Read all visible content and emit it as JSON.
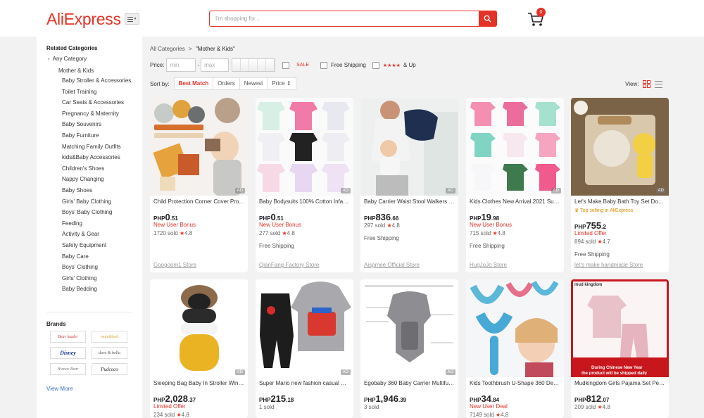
{
  "header": {
    "logo": "AliExpress",
    "search_placeholder": "I'm shopping for...",
    "cart_count": "0",
    "brand_color": "#e43225"
  },
  "sidebar": {
    "title": "Related Categories",
    "back_label": "Any Category",
    "current": "Mother & Kids",
    "items": [
      "Baby Stroller & Accessories",
      "Toilet Training",
      "Car Seats & Accessories",
      "Pregnancy & Maternity",
      "Baby Souvenirs",
      "Baby Furniture",
      "Matching Family Outfits",
      "kids&Baby Accessories",
      "Children's Shoes",
      "Nappy Changing",
      "Baby Shoes",
      "Girls' Baby Clothing",
      "Boys' Baby Clothing",
      "Feeding",
      "Activity & Gear",
      "Safety Equipment",
      "Baby Care",
      "Boys' Clothing",
      "Girls' Clothing",
      "Baby Bedding"
    ],
    "brands_title": "Brands",
    "brands": [
      "Bear leader",
      "mom&bab",
      "Disney",
      "dave & bella",
      "Humor Bear",
      "Pudcoco"
    ],
    "view_more": "View More"
  },
  "breadcrumb": {
    "root": "All Categories",
    "sep": ">",
    "current": "\"Mother & Kids\""
  },
  "filters": {
    "price_label": "Price:",
    "min_placeholder": "min",
    "dash": "-",
    "max_placeholder": "max",
    "sale_label": "SALE",
    "free_shipping_label": "Free Shipping",
    "rating_stars": "★★★★",
    "rating_label": "& Up"
  },
  "sort": {
    "label": "Sort by:",
    "options": [
      "Best Match",
      "Orders",
      "Newest",
      "Price ⇕"
    ],
    "active": "Best Match"
  },
  "view": {
    "label": "View:"
  },
  "products": [
    {
      "title": "Child Protection Corner Cover Prot…",
      "currency": "PHP",
      "price_int": "0",
      "price_dec": ".51",
      "promo": "New User Bonus",
      "sold": "1720 sold",
      "rating": "4.8",
      "shipping": "",
      "store": "Googoom1 Store",
      "ad": "AD"
    },
    {
      "title": "Baby Bodysuits 100% Cotton Infan…",
      "currency": "PHP",
      "price_int": "0",
      "price_dec": ".51",
      "promo": "New User Bonus",
      "sold": "277 sold",
      "rating": "4.8",
      "shipping": "Free Shipping",
      "store": "QianFang Factory Store",
      "ad": "AD"
    },
    {
      "title": "Baby Carrier Waist Stool Walkers B…",
      "currency": "PHP",
      "price_int": "836",
      "price_dec": ".66",
      "promo": "",
      "sold": "297 sold",
      "rating": "4.8",
      "shipping": "Free Shipping",
      "store": "Aispmee Official Store",
      "ad": "AD"
    },
    {
      "title": "Kids Clothes New Arrival 2021 Sum…",
      "currency": "PHP",
      "price_int": "19",
      "price_dec": ".98",
      "promo": "New User Bonus",
      "sold": "715 sold",
      "rating": "4.8",
      "shipping": "Free Shipping",
      "store": "HugJoJo Store",
      "ad": "AD"
    },
    {
      "title": "Let's Make Baby Bath Toy Set Dou…",
      "top_selling": "Top selling in AliExpress",
      "currency": "PHP",
      "price_int": "755",
      "price_dec": ".2",
      "promo": "Limited Offer",
      "sold": "894 sold",
      "rating": "4.7",
      "shipping": "Free Shipping",
      "store": "let's make handmade Store",
      "ad": "AD"
    },
    {
      "title": "Sleeping Bag Baby In Stroller Wint…",
      "currency": "PHP",
      "price_int": "2,028",
      "price_dec": ".37",
      "promo": "Limited Offer",
      "sold": "234 sold",
      "rating": "4.8",
      "shipping": "",
      "store": "",
      "ad": "AD"
    },
    {
      "title": "Super Mario new fashion casual m…",
      "currency": "PHP",
      "price_int": "215",
      "price_dec": ".18",
      "promo": "",
      "sold": "1 sold",
      "rating": "",
      "shipping": "",
      "store": "",
      "ad": "AD"
    },
    {
      "title": "Egobaby 360 Baby Carrier Multifun…",
      "currency": "PHP",
      "price_int": "1,946",
      "price_dec": ".39",
      "promo": "",
      "sold": "3 sold",
      "rating": "",
      "shipping": "",
      "store": "",
      "ad": "AD"
    },
    {
      "title": "Kids Toothbrush U-Shape 360 Deg…",
      "currency": "PHP",
      "price_int": "34",
      "price_dec": ".84",
      "promo": "New User Deal",
      "sold": "7149 sold",
      "rating": "4.8",
      "shipping": "",
      "store": "",
      "ad": ""
    },
    {
      "title": "Mudkingdom Girls Pajama Set Pet…",
      "currency": "PHP",
      "price_int": "812",
      "price_dec": ".07",
      "promo": "",
      "sold": "209 sold",
      "rating": "4.8",
      "shipping": "",
      "store": "",
      "ad": "",
      "banner_brand": "mud kingdom",
      "banner_line1": "During Chinese New Year",
      "banner_line2": "the product will be shipped daily"
    }
  ]
}
